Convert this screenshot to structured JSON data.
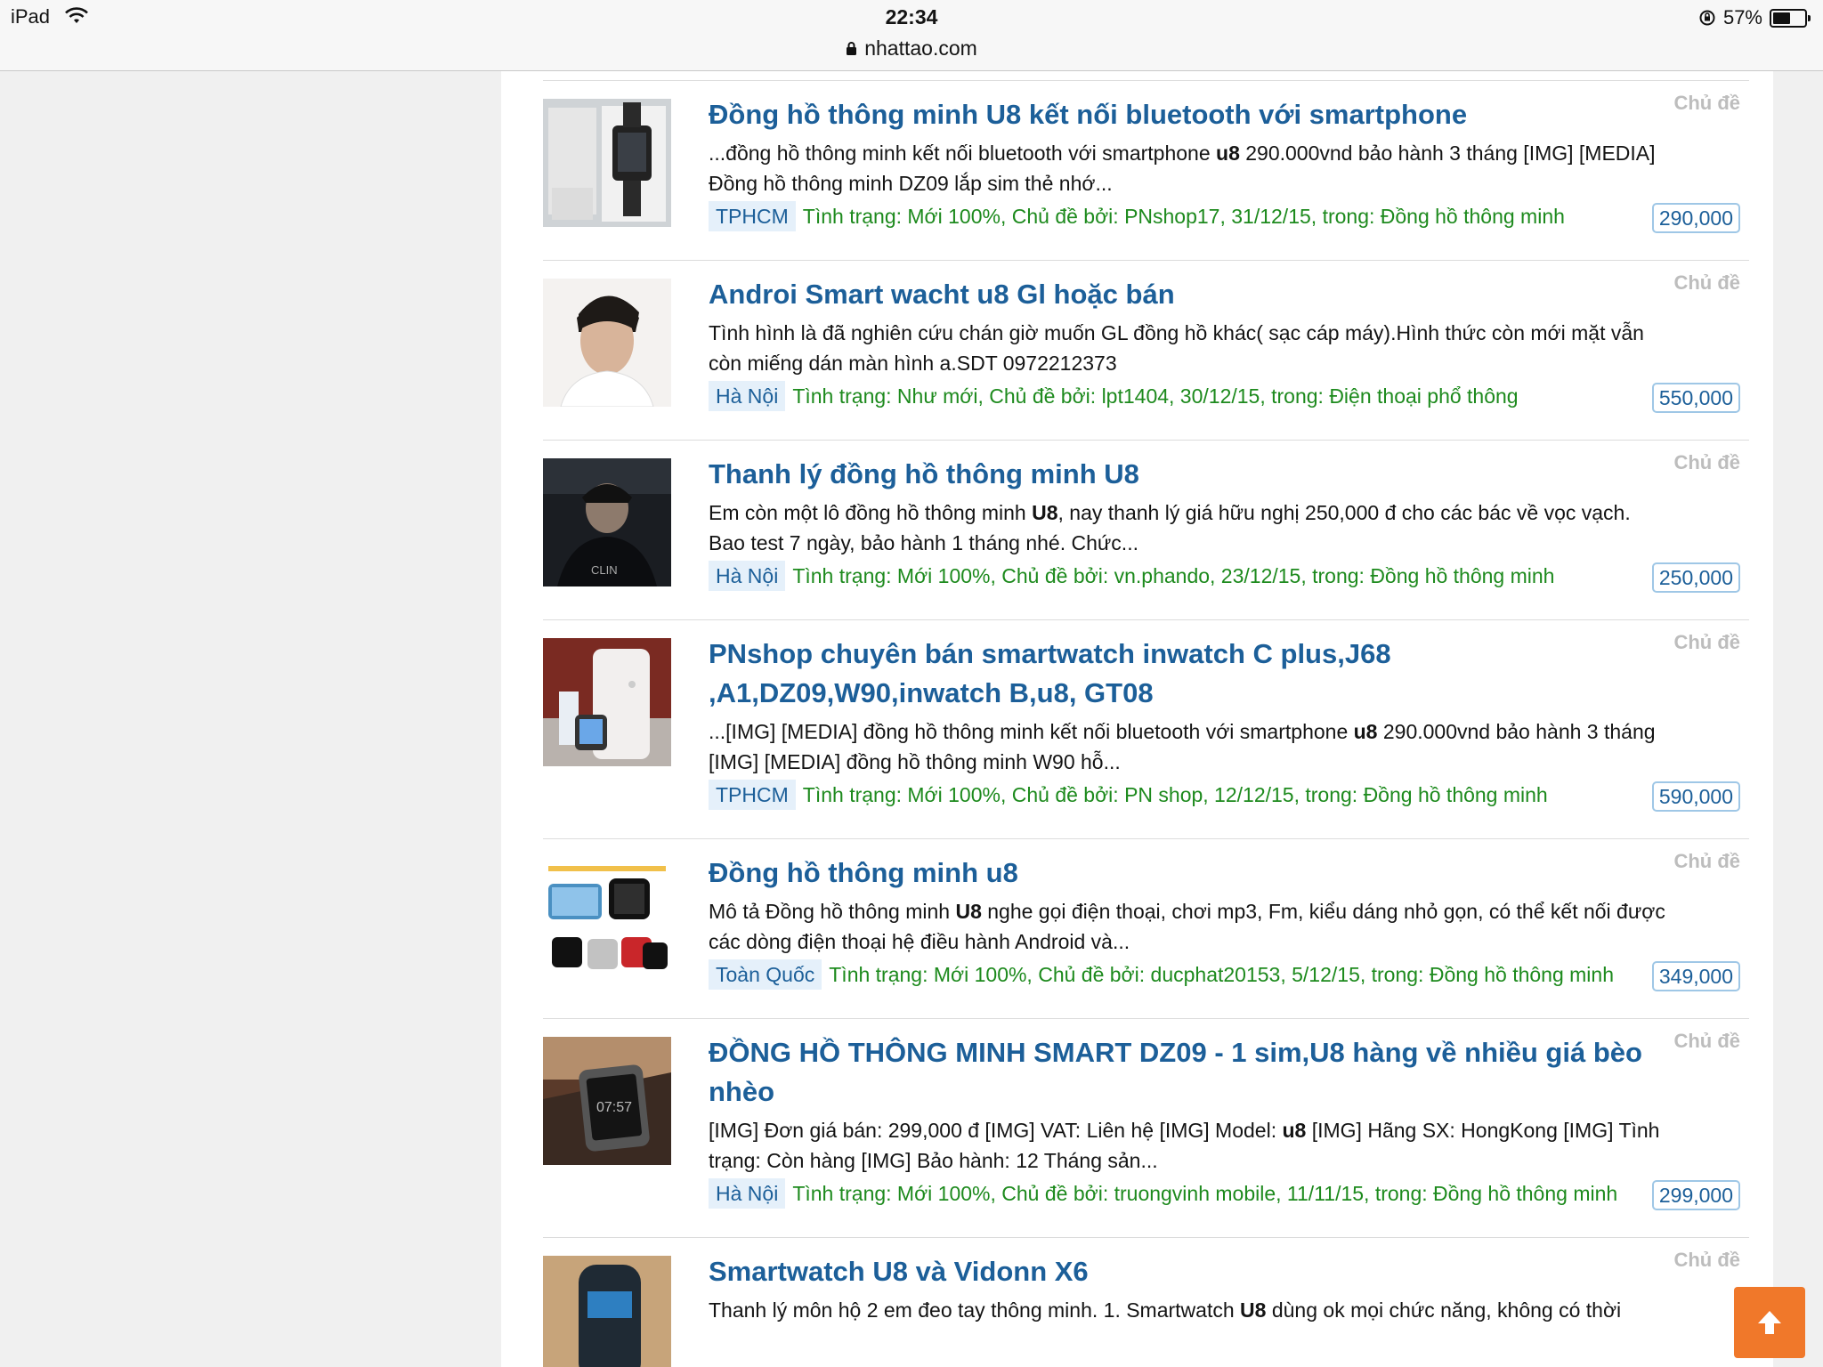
{
  "status_bar": {
    "device": "iPad",
    "time": "22:34",
    "url": "nhattao.com",
    "battery": "57%",
    "battery_level": 0.57
  },
  "results": [
    {
      "title": "Đồng hồ thông minh U8 kết nối bluetooth với smartphone",
      "snippet": [
        {
          "t": "...đồng hồ thông minh kết nối bluetooth với smartphone ",
          "b": false
        },
        {
          "t": "u8",
          "b": true
        },
        {
          "t": " 290.000vnd bảo hành 3 tháng [IMG] [MEDIA] Đồng hồ thông minh DZ09 lắp sim thẻ nhớ...",
          "b": false
        }
      ],
      "location": "TPHCM",
      "meta": "Tình trạng: Mới 100%, Chủ đề bởi: PNshop17, 31/12/15, trong: Đồng hồ thông minh",
      "type": "Chủ đề",
      "price": "290,000",
      "thumb": "watch-box-photo"
    },
    {
      "title": "Androi Smart wacht u8 Gl hoặc bán",
      "snippet": [
        {
          "t": "Tình hình là đã nghiên cứu chán giờ muốn GL đồng hồ khác( sạc cáp máy).Hình thức còn mới mặt vẫn còn miếng dán màn hình a.SDT 0972212373",
          "b": false
        }
      ],
      "location": "Hà Nội",
      "meta": "Tình trạng: Như mới, Chủ đề bởi: lpt1404, 30/12/15, trong: Điện thoại phổ thông",
      "type": "Chủ đề",
      "price": "550,000",
      "thumb": "man-portrait-photo"
    },
    {
      "title": "Thanh lý đồng hồ thông minh U8",
      "snippet": [
        {
          "t": "Em còn một lô đồng hồ thông minh ",
          "b": false
        },
        {
          "t": "U8",
          "b": true
        },
        {
          "t": ", nay thanh lý giá hữu nghị 250,000 đ cho các bác về vọc vạch. Bao test 7 ngày, bảo hành 1 tháng nhé. Chức...",
          "b": false
        }
      ],
      "location": "Hà Nội",
      "meta": "Tình trạng: Mới 100%, Chủ đề bởi: vn.phando, 23/12/15, trong: Đồng hồ thông minh",
      "type": "Chủ đề",
      "price": "250,000",
      "thumb": "dark-portrait-photo"
    },
    {
      "title": "PNshop chuyên bán smartwatch inwatch C plus,J68 ,A1,DZ09,W90,inwatch B,u8, GT08",
      "snippet": [
        {
          "t": "...[IMG] [MEDIA] đồng hồ thông minh kết nối bluetooth với smartphone ",
          "b": false
        },
        {
          "t": "u8",
          "b": true
        },
        {
          "t": " 290.000vnd bảo hành 3 tháng [IMG] [MEDIA] đồng hồ thông minh W90 hỗ...",
          "b": false
        }
      ],
      "location": "TPHCM",
      "meta": "Tình trạng: Mới 100%, Chủ đề bởi: PN shop, 12/12/15, trong: Đồng hồ thông minh",
      "type": "Chủ đề",
      "price": "590,000",
      "thumb": "phone-and-watch-photo"
    },
    {
      "title": "Đồng hồ thông minh u8",
      "snippet": [
        {
          "t": "Mô tả Đồng hồ thông minh ",
          "b": false
        },
        {
          "t": "U8",
          "b": true
        },
        {
          "t": " nghe gọi điện thoại, chơi mp3, Fm, kiểu dáng nhỏ gọn, có thể kết nối được các dòng điện thoại hệ điều hành Android và...",
          "b": false
        }
      ],
      "location": "Toàn Quốc",
      "meta": "Tình trạng: Mới 100%, Chủ đề bởi: ducphat20153, 5/12/15, trong: Đồng hồ thông minh",
      "type": "Chủ đề",
      "price": "349,000",
      "thumb": "colored-watches-photo"
    },
    {
      "title": "ĐỒNG HỒ THÔNG MINH SMART DZ09 - 1 sim,U8 hàng về nhiều giá bèo nhèo",
      "snippet": [
        {
          "t": "[IMG] Đơn giá bán: 299,000 đ [IMG] VAT: Liên hệ [IMG] Model: ",
          "b": false
        },
        {
          "t": "u8",
          "b": true
        },
        {
          "t": " [IMG] Hãng SX: HongKong [IMG] Tình trạng: Còn hàng [IMG] Bảo hành: 12 Tháng sản...",
          "b": false
        }
      ],
      "location": "Hà Nội",
      "meta": "Tình trạng: Mới 100%, Chủ đề bởi: truongvinh mobile, 11/11/15, trong: Đồng hồ thông minh",
      "type": "Chủ đề",
      "price": "299,000",
      "thumb": "dz09-watch-photo"
    },
    {
      "title": "Smartwatch U8 và Vidonn X6",
      "snippet": [
        {
          "t": "Thanh lý môn hộ 2 em đeo tay thông minh. 1. Smartwatch ",
          "b": false
        },
        {
          "t": "U8",
          "b": true
        },
        {
          "t": " dùng ok mọi chức năng, không có thời",
          "b": false
        }
      ],
      "location": "",
      "meta": "",
      "type": "Chủ đề",
      "price": "",
      "thumb": "wristband-photo"
    }
  ]
}
